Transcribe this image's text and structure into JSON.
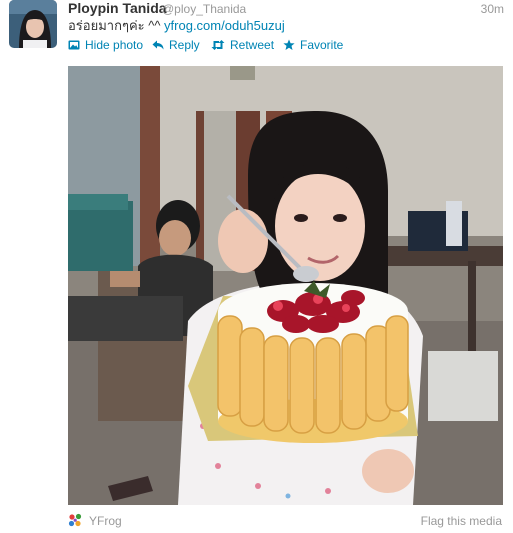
{
  "tweet": {
    "fullname": "Ploypin Tanida",
    "username": "@ploy_Thanida",
    "time": "30m",
    "text_prefix": "อร่อยมากๆค่ะ ^^ ",
    "link": "yfrog.com/oduh5uzuj"
  },
  "actions": {
    "hide_photo": "Hide photo",
    "reply": "Reply",
    "retweet": "Retweet",
    "favorite": "Favorite"
  },
  "media": {
    "provider": "YFrog",
    "flag": "Flag this media"
  },
  "colors": {
    "link": "#0084b4",
    "muted": "#999999",
    "text": "#333333"
  },
  "icons": [
    "photo-icon",
    "reply-icon",
    "retweet-icon",
    "favorite-icon",
    "yfrog-logo-icon"
  ]
}
